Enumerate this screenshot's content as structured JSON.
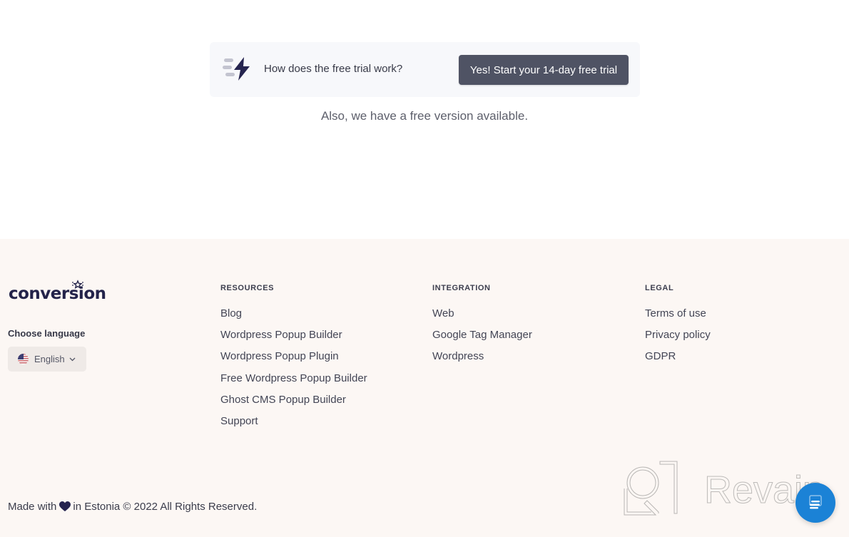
{
  "trial": {
    "question": "How does the free trial work?",
    "cta_label": "Yes! Start your 14-day free trial",
    "free_version_note": "Also, we have a free version available."
  },
  "footer": {
    "logo_text": "conversion",
    "language": {
      "label": "Choose language",
      "selected": "English"
    },
    "columns": [
      {
        "title": "RESOURCES",
        "links": [
          "Blog",
          "Wordpress Popup Builder",
          "Wordpress Popup Plugin",
          "Free Wordpress Popup Builder",
          "Ghost CMS Popup Builder",
          "Support"
        ]
      },
      {
        "title": "INTEGRATION",
        "links": [
          "Web",
          "Google Tag Manager",
          "Wordpress"
        ]
      },
      {
        "title": "LEGAL",
        "links": [
          "Terms of use",
          "Privacy policy",
          "GDPR"
        ]
      }
    ],
    "copyright": {
      "prefix": "Made with",
      "suffix": "in Estonia © 2022 All Rights Reserved."
    }
  },
  "watermark": {
    "text": "Revain"
  },
  "colors": {
    "cta_bg": "#4f5364",
    "brand_navy": "#23234a",
    "footer_bg": "#fcf7f4",
    "chat_blue": "#1b82d6"
  }
}
